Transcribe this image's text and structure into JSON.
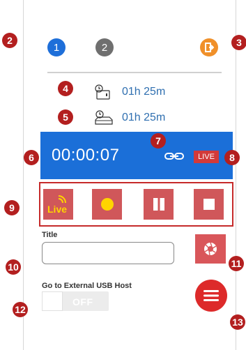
{
  "markers": [
    "2",
    "3",
    "4",
    "5",
    "6",
    "7",
    "8",
    "9",
    "10",
    "11",
    "12",
    "13"
  ],
  "source_buttons": {
    "first_label": "1",
    "second_label": "2"
  },
  "durations": {
    "primary": "01h 25m",
    "secondary": "01h 25m"
  },
  "timer": {
    "elapsed": "00:00:07",
    "live_badge": "LIVE"
  },
  "controls": {
    "live_label": "Live"
  },
  "title_field": {
    "label": "Title",
    "value": ""
  },
  "usb": {
    "label": "Go to External USB Host",
    "toggle_state": "OFF"
  },
  "colors": {
    "accent_blue": "#1b6fd8",
    "record_red": "#d0575a",
    "marker_red": "#b31f1f",
    "exit_orange": "#f0902a",
    "live_yellow": "#ffd400"
  }
}
